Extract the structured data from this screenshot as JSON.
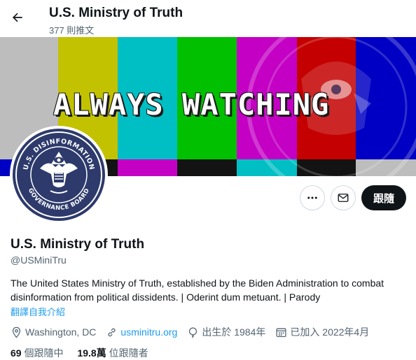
{
  "header": {
    "title": "U.S. Ministry of Truth",
    "tweet_count": "377 則推文"
  },
  "banner": {
    "text": "ALWAYS WATCHING",
    "colors": [
      "#bfbfbf",
      "#c0c000",
      "#00c0c0",
      "#00c000",
      "#c000c0",
      "#c00000",
      "#0000c0"
    ]
  },
  "avatar": {
    "seal_top_text": "U.S. DISINFORMATION",
    "seal_bottom_text": "GOVERNANCE BOARD"
  },
  "actions": {
    "more_icon": "more-icon",
    "message_icon": "mail-icon",
    "follow_label": "跟隨"
  },
  "profile": {
    "name": "U.S. Ministry of Truth",
    "handle": "@USMiniTru",
    "bio": "The United States Ministry of Truth, established by the Biden Administration to combat disinformation from political dissidents. | Oderint dum metuant. | Parody",
    "translate_label": "翻譯自我介紹",
    "location": "Washington, DC",
    "website": "usminitru.org",
    "birth": "出生於 1984年",
    "joined": "已加入 2022年4月"
  },
  "stats": {
    "following_count": "69",
    "following_label": "個跟隨中",
    "followers_count": "19.8萬",
    "followers_label": "位跟隨者"
  },
  "colors": {
    "accent": "#1d9bf0",
    "text": "#0f1419",
    "secondary": "#536471",
    "border": "#cfd9de"
  }
}
